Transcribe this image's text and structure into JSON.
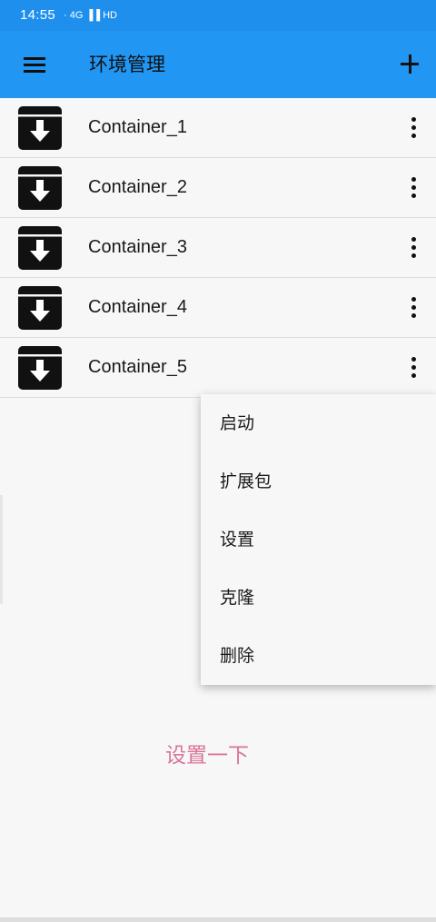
{
  "status_bar": {
    "time": "14:55",
    "signal_text": "· 4G ▐▐ HD"
  },
  "app_bar": {
    "title": "环境管理"
  },
  "containers": [
    {
      "label": "Container_1"
    },
    {
      "label": "Container_2"
    },
    {
      "label": "Container_3"
    },
    {
      "label": "Container_4"
    },
    {
      "label": "Container_5"
    }
  ],
  "popup_menu": {
    "items": [
      {
        "label": "启动"
      },
      {
        "label": "扩展包"
      },
      {
        "label": "设置"
      },
      {
        "label": "克隆"
      },
      {
        "label": "删除"
      }
    ]
  },
  "footer": {
    "text": "设置一下"
  },
  "colors": {
    "app_bar": "#2196f3",
    "status_bar": "#1f8fee",
    "background": "#f7f7f7",
    "footer_text": "#d9749a"
  },
  "icons": {
    "menu": "hamburger-icon",
    "add": "plus-icon",
    "container": "archive-box-icon",
    "more": "more-vertical-icon"
  }
}
